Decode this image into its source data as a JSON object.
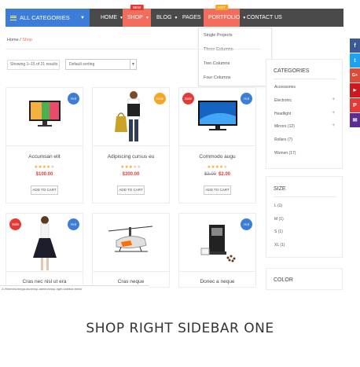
{
  "nav": {
    "categories_label": "All Categories",
    "items": [
      {
        "label": "Home",
        "badge": ""
      },
      {
        "label": "Shop",
        "badge": "New"
      },
      {
        "label": "Blog",
        "badge": ""
      },
      {
        "label": "Pages",
        "badge": ""
      },
      {
        "label": "Portfolio",
        "badge": "Hot"
      },
      {
        "label": "Contact Us",
        "badge": ""
      }
    ]
  },
  "dropdown": [
    "Single Projects",
    "Three Columns",
    "Two Columns",
    "Four Columns"
  ],
  "breadcrumb": {
    "home": "Home",
    "sep": " / ",
    "current": "Shop"
  },
  "toolbar": {
    "result_count": "Showing 1–15 of 21 results",
    "sort_label": "Default sorting"
  },
  "products": [
    {
      "name": "Accumsan elit",
      "rating": 4,
      "price": "$100.00",
      "old_price": "",
      "badge": "Hot",
      "badge_type": "hot",
      "badge_side": "right",
      "cart": "Add to cart",
      "image": "tv"
    },
    {
      "name": "Adipiscing cursus eu",
      "rating": 3,
      "price": "$300.00",
      "old_price": "",
      "badge": "New",
      "badge_type": "new",
      "badge_side": "right",
      "cart": "Add to cart",
      "image": "woman-bag"
    },
    {
      "name": "Commodo augu",
      "rating": 4,
      "price": "$2.00",
      "old_price": "$3.00",
      "badge": "Sale",
      "badge_type": "sale",
      "badge_side": "left",
      "badge2": "Hot",
      "cart": "Add to cart",
      "image": "monitor"
    },
    {
      "name": "Cras nec nisl ut era",
      "rating": 0,
      "price": "",
      "old_price": "",
      "badge": "Sale",
      "badge_type": "sale",
      "badge_side": "left",
      "badge2": "Hot",
      "cart": "",
      "image": "dress"
    },
    {
      "name": "Cras neque",
      "rating": 0,
      "price": "",
      "old_price": "",
      "badge": "",
      "badge_type": "",
      "badge_side": "",
      "cart": "",
      "image": "drone"
    },
    {
      "name": "Donec a neque",
      "rating": 0,
      "price": "",
      "old_price": "",
      "badge": "Hot",
      "badge_type": "hot",
      "badge_side": "right",
      "cart": "",
      "image": "coffee"
    }
  ],
  "sidebar": {
    "categories_title": "Categories",
    "categories": [
      {
        "label": "Accessories",
        "plus": false
      },
      {
        "label": "Electronic",
        "plus": true
      },
      {
        "label": "Headlight",
        "plus": true
      },
      {
        "label": "Mirrors (12)",
        "plus": true
      },
      {
        "label": "Rollers (7)",
        "plus": false
      },
      {
        "label": "Women (17)",
        "plus": false
      }
    ],
    "size_title": "Size",
    "sizes": [
      "L (1)",
      "M (1)",
      "S (1)",
      "XL (1)"
    ],
    "color_title": "Color"
  },
  "social": [
    {
      "icon": "facebook-icon",
      "glyph": "f",
      "color": "#3b5998"
    },
    {
      "icon": "twitter-icon",
      "glyph": "t",
      "color": "#1da1f2"
    },
    {
      "icon": "google-plus-icon",
      "glyph": "G+",
      "color": "#dd4b39"
    },
    {
      "icon": "youtube-icon",
      "glyph": "▶",
      "color": "#cc181e"
    },
    {
      "icon": "pinterest-icon",
      "glyph": "P",
      "color": "#e53935"
    },
    {
      "icon": "email-icon",
      "glyph": "✉",
      "color": "#5c2d91"
    }
  ],
  "status_url": "2://themes/mega-store/wp-admin/shop-right-sidebar.html#",
  "footer_title": "Shop Right Sidebar One",
  "colors": {
    "accent": "#3b7dd8",
    "highlight": "#f26d5b",
    "nav_bg": "#4a4a4a",
    "price": "#e53935"
  }
}
